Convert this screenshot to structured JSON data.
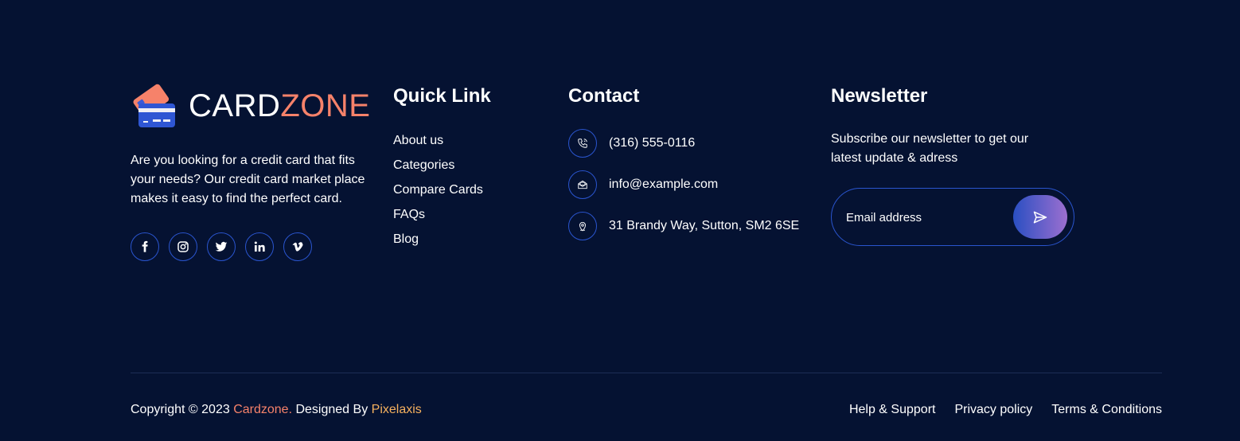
{
  "brand": {
    "name_part1": "CARD",
    "name_part2": "ZONE",
    "description": "Are you looking for a credit card that fits your needs? Our credit card market place makes it easy to find the perfect card.",
    "socials": [
      "facebook-icon",
      "instagram-icon",
      "twitter-icon",
      "linkedin-icon",
      "vimeo-icon"
    ]
  },
  "quick_links": {
    "title": "Quick Link",
    "items": [
      "About us",
      "Categories",
      "Compare Cards",
      "FAQs",
      "Blog"
    ]
  },
  "contact": {
    "title": "Contact",
    "phone": "(316) 555-0116",
    "email": "info@example.com",
    "address": "31 Brandy Way, Sutton, SM2 6SE"
  },
  "newsletter": {
    "title": "Newsletter",
    "description": "Subscribe our newsletter to get our latest update & adress",
    "placeholder": "Email address"
  },
  "footer_bottom": {
    "copyright_prefix": "Copyright © 2023 ",
    "brand_link": "Cardzone.",
    "designed_by": " Designed By ",
    "designer": "Pixelaxis",
    "links": [
      "Help & Support",
      "Privacy policy",
      "Terms & Conditions"
    ]
  },
  "colors": {
    "background": "#051232",
    "accent_orange": "#f6826a",
    "accent_gold": "#f6b15e",
    "border_blue": "#2a55cf"
  }
}
